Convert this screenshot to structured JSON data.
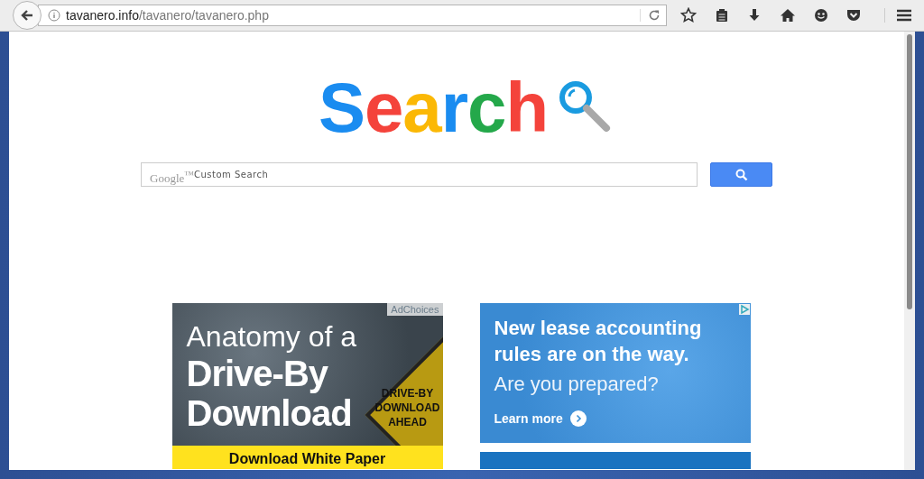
{
  "browser": {
    "url": {
      "domain": "tavanero.info",
      "path": "/tavanero/tavanero.php"
    }
  },
  "logo": {
    "letters": [
      {
        "char": "S",
        "color": "#1a8cf0"
      },
      {
        "char": "e",
        "color": "#f4433b"
      },
      {
        "char": "a",
        "color": "#fbb805"
      },
      {
        "char": "r",
        "color": "#1a8cf0"
      },
      {
        "char": "c",
        "color": "#24a84a"
      },
      {
        "char": "h",
        "color": "#f4433b"
      }
    ]
  },
  "search": {
    "brand": "Google$^{™}$",
    "placeholder": "Custom Search"
  },
  "ads": [
    {
      "kind": "sign",
      "adchoices": "AdChoices",
      "headline": [
        "Anatomy of a",
        "Drive-By",
        "Download"
      ],
      "sign_text": [
        "DRIVE-BY",
        "DOWNLOAD",
        "AHEAD"
      ],
      "footer": "Download White Paper"
    },
    {
      "kind": "lease",
      "headline": "New lease accounting rules are on the way.",
      "subline": "Are you prepared?",
      "cta": "Learn more"
    }
  ]
}
